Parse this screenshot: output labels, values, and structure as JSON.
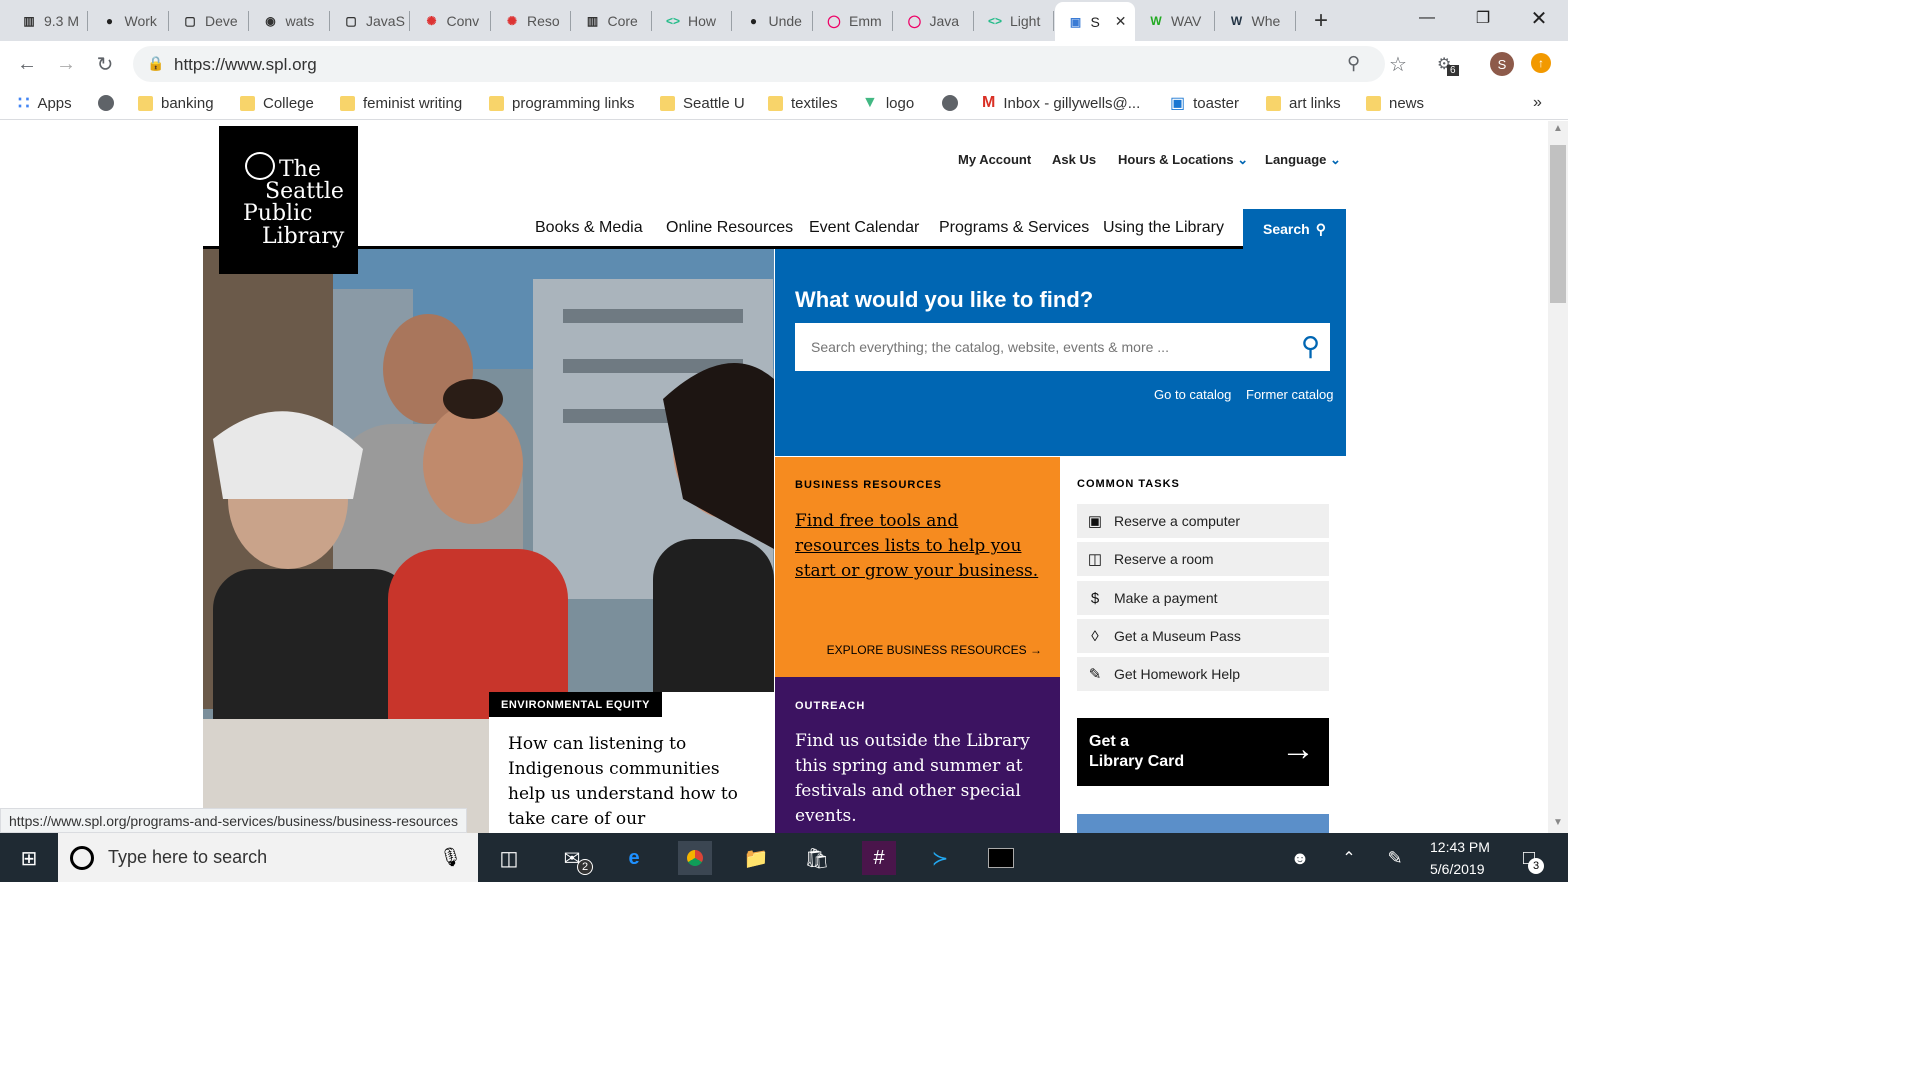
{
  "browser": {
    "tabs": [
      {
        "label": "9.3 M",
        "icon": "book-icon"
      },
      {
        "label": "Work",
        "icon": "lightbulb-icon"
      },
      {
        "label": "Deve",
        "icon": "square-icon"
      },
      {
        "label": "wats",
        "icon": "github-icon"
      },
      {
        "label": "JavaS",
        "icon": "doc-icon"
      },
      {
        "label": "Conv",
        "icon": "gear-red-icon"
      },
      {
        "label": "Reso",
        "icon": "gear-red-icon"
      },
      {
        "label": "Core",
        "icon": "book-icon"
      },
      {
        "label": "How",
        "icon": "code-icon"
      },
      {
        "label": "Unde",
        "icon": "lightbulb-icon"
      },
      {
        "label": "Emm",
        "icon": "spiral-icon"
      },
      {
        "label": "Java",
        "icon": "spiral-icon"
      },
      {
        "label": "Light",
        "icon": "code-icon"
      },
      {
        "label": "S",
        "icon": "spl-icon"
      },
      {
        "label": "WAV",
        "icon": "w-icon"
      },
      {
        "label": "Whe",
        "icon": "wiki-icon"
      }
    ],
    "url": "https://www.spl.org",
    "extension_badge": "6",
    "profile_initial": "S",
    "bookmarks": [
      {
        "label": "Apps",
        "icon": "apps-icon"
      },
      {
        "label": "",
        "icon": "globe-icon"
      },
      {
        "label": "banking",
        "icon": "folder-icon"
      },
      {
        "label": "College",
        "icon": "folder-icon"
      },
      {
        "label": "feminist writing",
        "icon": "folder-icon"
      },
      {
        "label": "programming links",
        "icon": "folder-icon"
      },
      {
        "label": "Seattle U",
        "icon": "folder-icon"
      },
      {
        "label": "textiles",
        "icon": "folder-icon"
      },
      {
        "label": "logo",
        "icon": "vue-icon"
      },
      {
        "label": "",
        "icon": "globe-icon"
      },
      {
        "label": "Inbox - gillywells@...",
        "icon": "gmail-icon"
      },
      {
        "label": "toaster",
        "icon": "dsm-icon"
      },
      {
        "label": "art links",
        "icon": "folder-icon"
      },
      {
        "label": "news",
        "icon": "folder-icon"
      }
    ],
    "status_url": "https://www.spl.org/programs-and-services/business/business-resources"
  },
  "site": {
    "logo_lines": [
      "The",
      "Seattle",
      "Public",
      "Library"
    ],
    "top_links": [
      "My Account",
      "Ask Us",
      "Hours & Locations",
      "Language"
    ],
    "main_nav": [
      "Books & Media",
      "Online Resources",
      "Event Calendar",
      "Programs & Services",
      "Using the Library"
    ],
    "search_nav_label": "Search",
    "find": {
      "heading": "What would you like to find?",
      "placeholder": "Search everything; the catalog, website, events & more ...",
      "go_catalog": "Go to catalog",
      "former_catalog": "Former catalog"
    },
    "business": {
      "kicker": "BUSINESS RESOURCES",
      "body": "Find free tools and resources lists to help you start or grow your business.",
      "explore": "EXPLORE BUSINESS RESOURCES"
    },
    "outreach": {
      "kicker": "OUTREACH",
      "body": "Find us outside the Library this spring and summer at festivals and other special events."
    },
    "environment": {
      "tag": "ENVIRONMENTAL EQUITY",
      "body": "How can listening to Indigenous communities help us understand how to take care of our environment?"
    },
    "common_tasks": {
      "heading": "COMMON TASKS",
      "items": [
        {
          "label": "Reserve a computer",
          "icon": "computer-icon"
        },
        {
          "label": "Reserve a room",
          "icon": "room-icon"
        },
        {
          "label": "Make a payment",
          "icon": "payment-icon"
        },
        {
          "label": "Get a Museum Pass",
          "icon": "ticket-icon"
        },
        {
          "label": "Get Homework Help",
          "icon": "homework-icon"
        }
      ],
      "card_line1": "Get a",
      "card_line2": "Library Card"
    },
    "colors": {
      "blue": "#0066b3",
      "orange": "#f68b1f",
      "purple": "#3c1361"
    }
  },
  "taskbar": {
    "search_placeholder": "Type here to search",
    "mail_badge": "2",
    "time": "12:43 PM",
    "date": "5/6/2019",
    "notification_badge": "3"
  }
}
